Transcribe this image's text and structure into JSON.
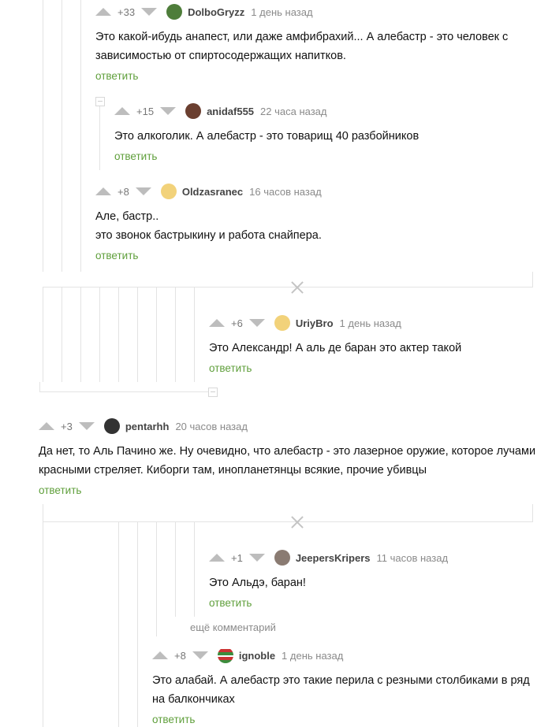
{
  "reply_label": "ответить",
  "more_comments_label": "ещё комментарий",
  "comments": [
    {
      "rating": "+33",
      "user": "DolboGryzz",
      "time": "1 день назад",
      "lines": [
        "Это какой-ибудь анапест, или даже амфибрахий... А алебастр - это человек с",
        "зависимостью от спиртосодержащих напитков."
      ]
    },
    {
      "rating": "+15",
      "user": "anidaf555",
      "time": "22 часа назад",
      "lines": [
        "Это алкоголик. А алебастр - это товарищ 40 разбойников"
      ]
    },
    {
      "rating": "+8",
      "user": "Oldzasranec",
      "time": "16 часов назад",
      "lines": [
        "Але, бастр..",
        "это звонок бастрыкину и работа снайпера."
      ]
    },
    {
      "rating": "+6",
      "user": "UriyBro",
      "time": "1 день назад",
      "lines": [
        "Это Александр! А аль де баран это актер такой"
      ]
    },
    {
      "rating": "+3",
      "user": "pentarhh",
      "time": "20 часов назад",
      "lines": [
        "Да нет, то Аль Пачино же. Ну очевидно, что алебастр - это лазерное оружие, которое лучами",
        "красными стреляет. Киборги там, инопланетянцы всякие, прочие убивцы"
      ]
    },
    {
      "rating": "+1",
      "user": "JeepersKripers",
      "time": "11 часов назад",
      "lines": [
        "Это Альдэ, баран!"
      ]
    },
    {
      "rating": "+8",
      "user": "ignoble",
      "time": "1 день назад",
      "lines": [
        "Это алабай. А алебастр это такие перила с резными столбиками в ряд",
        "на балкончиках"
      ]
    }
  ],
  "colors": {
    "accent": "#5f9f3b",
    "muted": "#8a8a8a",
    "arrow": "#bdbdbd",
    "line": "#e3e3e3"
  }
}
